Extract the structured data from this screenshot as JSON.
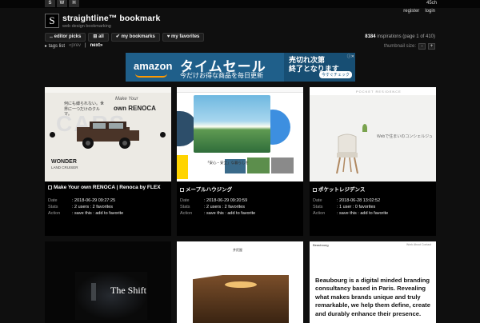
{
  "toolbar": {
    "s": "S",
    "w": "W",
    "h": "H",
    "right": "45ch"
  },
  "site": {
    "logo_letter": "S",
    "title": "straightline™ bookmark",
    "subtitle": "web design bookmarking"
  },
  "auth": {
    "register": "register",
    "login": "login"
  },
  "nav": {
    "editor_picks": "editor picks",
    "all": "all",
    "my_bookmarks": "my bookmarks",
    "my_favorites": "my favorites"
  },
  "inspirations": {
    "count": "8184",
    "label": "inspirations (page 1 of 410)"
  },
  "subnav": {
    "tags": "tags list",
    "prev": "«prev",
    "next": "next»"
  },
  "thumb": {
    "label": "thumbnail size:",
    "minus": "-",
    "plus": "+"
  },
  "ad": {
    "brand": "amazon",
    "headline": "タイムセール",
    "sub": "今だけお得な商品を毎日更新",
    "right_line1": "売切れ次第",
    "right_line2": "終了となります",
    "cta": "今すぐチェック",
    "close": "ⓘ✕"
  },
  "meta_labels": {
    "date": "Date",
    "stats": "Stats",
    "action": "Action"
  },
  "cards": [
    {
      "title": "Make Your own RENOCA | Renoca by FLEX",
      "date": ": 2018-06-29 09:27:25",
      "stats": ": 2 users : 2 favorites",
      "action": ": save this : add to favorite",
      "shot": {
        "text": "何にも縛られない。世界に一つだけのクルマ。",
        "made": "Make Your",
        "renoca": "own RENOCA",
        "bg": "CARS",
        "wonder": "WONDER",
        "lc": "LAND CRUISER"
      }
    },
    {
      "title": "メープルハウジング",
      "date": ": 2018-06-29 09:20:59",
      "stats": ": 2 users : 2 favorites",
      "action": ": save this : add to favorite",
      "shot": {
        "text": "「安心・安全」な暮らしを"
      }
    },
    {
      "title": "ポケットレジデンス",
      "date": ": 2018-06-28 13:02:52",
      "stats": ": 1 user : 0 favorites",
      "action": ": save this : add to favorite",
      "shot": {
        "title": "POCKET RESIDENCE",
        "text": "Webで住まいのコンシェルジュ"
      }
    },
    {
      "shot": {
        "text": "The Shift"
      }
    },
    {
      "shot": {
        "logo": "井尻屋"
      }
    },
    {
      "shot": {
        "brand": "Beaubourg",
        "nav": "Work  About  Contact",
        "text": "Beaubourg is a digital minded branding consultancy based in Paris. Revealing what makes brands unique and truly remarkable, we help them define, create and durably enhance their presence."
      }
    }
  ],
  "colors": {
    "background": "#0f0f0f",
    "ad_blue": "#1f5f8a",
    "amazon_orange": "#ff9900"
  }
}
